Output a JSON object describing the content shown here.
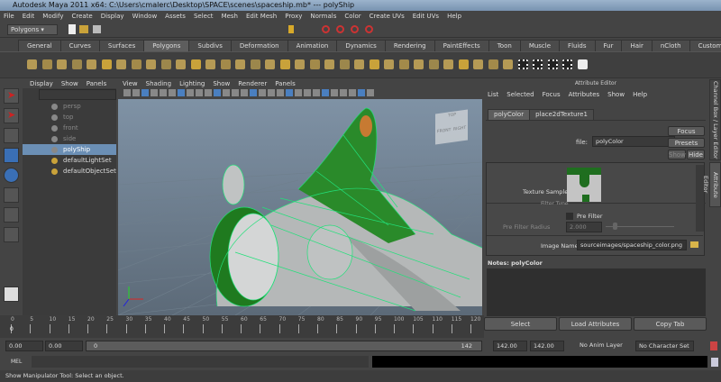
{
  "window": {
    "title": "Autodesk Maya 2011 x64: C:\\Users\\cmalerc\\Desktop\\SPACE\\scenes\\spaceship.mb*   ---   polyShip"
  },
  "menubar": [
    "File",
    "Edit",
    "Modify",
    "Create",
    "Display",
    "Window",
    "Assets",
    "Select",
    "Mesh",
    "Edit Mesh",
    "Proxy",
    "Normals",
    "Color",
    "Create UVs",
    "Edit UVs",
    "Help"
  ],
  "status_line": {
    "menuset": "Polygons"
  },
  "shelf": {
    "tabs": [
      "General",
      "Curves",
      "Surfaces",
      "Polygons",
      "Subdivs",
      "Deformation",
      "Animation",
      "Dynamics",
      "Rendering",
      "PaintEffects",
      "Toon",
      "Muscle",
      "Fluids",
      "Fur",
      "Hair",
      "nCloth",
      "Custom"
    ],
    "active": "Polygons"
  },
  "outliner": {
    "menu": [
      "Display",
      "Show",
      "Panels"
    ],
    "items": [
      {
        "label": "persp",
        "type": "camera"
      },
      {
        "label": "top",
        "type": "camera"
      },
      {
        "label": "front",
        "type": "camera"
      },
      {
        "label": "side",
        "type": "camera"
      },
      {
        "label": "polyShip",
        "type": "mesh",
        "selected": true
      },
      {
        "label": "defaultLightSet",
        "type": "set"
      },
      {
        "label": "defaultObjectSet",
        "type": "set"
      }
    ]
  },
  "viewport": {
    "menu": [
      "View",
      "Shading",
      "Lighting",
      "Show",
      "Renderer",
      "Panels"
    ],
    "viewcube": {
      "top": "TOP",
      "front": "FRONT",
      "right": "RIGHT"
    },
    "wire_color": "#22e07a",
    "shade_color": "#1e7a1e"
  },
  "attribute_editor": {
    "title": "Attribute Editor",
    "menu": [
      "List",
      "Selected",
      "Focus",
      "Attributes",
      "Show",
      "Help"
    ],
    "tabs": [
      "polyColor",
      "place2dTexture1"
    ],
    "active_tab": "polyColor",
    "file_label": "file:",
    "file_value": "polyColor",
    "buttons": {
      "focus": "Focus",
      "presets": "Presets",
      "show": "Show",
      "hide": "Hide"
    },
    "texture_sample_label": "Texture Sample",
    "filter_type_label": "Filter Type",
    "pre_filter_label": "Pre Filter",
    "pre_filter_checked": false,
    "pre_filter_radius_label": "Pre Filter Radius",
    "pre_filter_radius": "2.000",
    "image_name_label": "Image Name",
    "image_name": "sourceimages/spaceship_color.png",
    "notes_label": "Notes:  polyColor",
    "bottom_buttons": [
      "Select",
      "Load Attributes",
      "Copy Tab"
    ]
  },
  "side_tabs": [
    "Channel Box / Layer Editor",
    "Attribute Editor"
  ],
  "time_slider": {
    "ticks": [
      0,
      5,
      10,
      15,
      20,
      25,
      30,
      35,
      40,
      45,
      50,
      55,
      60,
      65,
      70,
      75,
      80,
      85,
      90,
      95,
      100,
      105,
      110,
      115,
      120
    ],
    "current": "0"
  },
  "range_slider": {
    "start_time": "0.00",
    "playback_start": "0.00",
    "range_start": "0",
    "range_end": "142",
    "playback_end": "142.00",
    "end_time": "142.00",
    "anim_layer": "No Anim Layer",
    "character_set": "No Character Set"
  },
  "command_line": {
    "label": "MEL",
    "value": ""
  },
  "help_line": "Show Manipulator Tool: Select an object."
}
